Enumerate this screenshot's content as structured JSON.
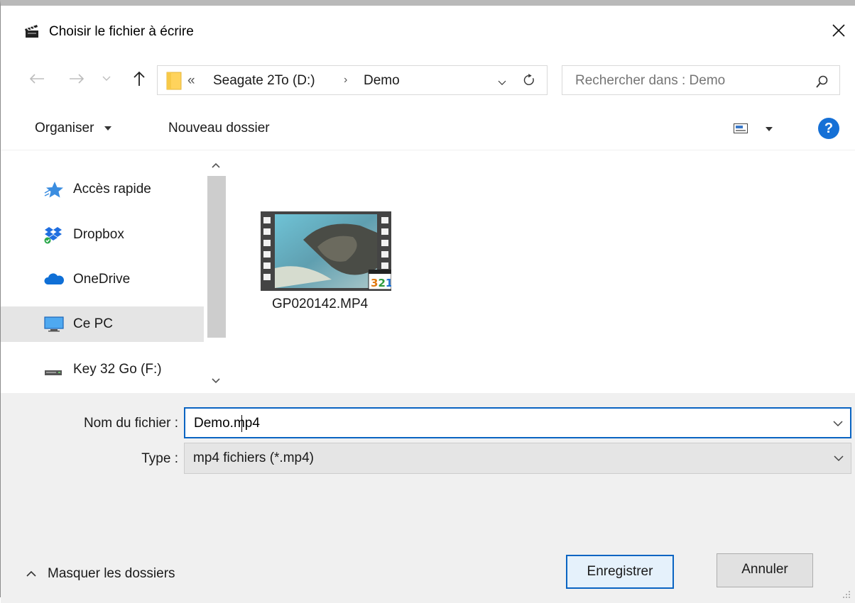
{
  "window": {
    "title": "Choisir le fichier à écrire",
    "icon": "clapperboard-icon"
  },
  "address": {
    "overflow": "«",
    "crumbs": [
      "Seagate 2To (D:)",
      "Demo"
    ],
    "separator": "›"
  },
  "search": {
    "placeholder": "Rechercher dans : Demo"
  },
  "toolbar": {
    "organize_label": "Organiser",
    "new_folder_label": "Nouveau dossier"
  },
  "sidebar": {
    "items": [
      {
        "label": "Accès rapide",
        "icon": "star-icon",
        "selected": false
      },
      {
        "label": "Dropbox",
        "icon": "dropbox-icon",
        "selected": false
      },
      {
        "label": "OneDrive",
        "icon": "cloud-icon",
        "selected": false
      },
      {
        "label": "Ce PC",
        "icon": "monitor-icon",
        "selected": true
      },
      {
        "label": "Key 32 Go (F:)",
        "icon": "drive-icon",
        "selected": false
      }
    ]
  },
  "files": [
    {
      "name": "GP020142.MP4",
      "overlay": "321"
    }
  ],
  "form": {
    "filename_label": "Nom du fichier :",
    "filename_value": "Demo.mp4",
    "type_label": "Type :",
    "type_value": "mp4 fichiers (*.mp4)"
  },
  "footer": {
    "hide_folders_label": "Masquer les dossiers",
    "save_label": "Enregistrer",
    "cancel_label": "Annuler"
  },
  "colors": {
    "accent": "#0a64c2",
    "selected_bg": "#e5e5e5",
    "panel_bg": "#f0f0f0",
    "help": "#1570d6"
  }
}
